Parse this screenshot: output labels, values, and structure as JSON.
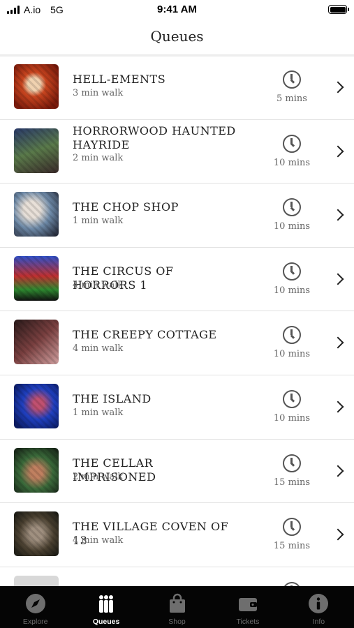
{
  "status": {
    "carrier": "A.io",
    "network": "5G",
    "time": "9:41 AM"
  },
  "nav": {
    "title": "Queues"
  },
  "queues": [
    {
      "name": "HELL-EMENTS",
      "walk": "3 min walk",
      "wait": "5 mins"
    },
    {
      "name": "HORRORWOOD HAUNTED HAYRIDE",
      "walk": "2 min walk",
      "wait": "10 mins"
    },
    {
      "name": "THE CHOP SHOP",
      "walk": "1 min walk",
      "wait": "10 mins"
    },
    {
      "name": "THE CIRCUS OF HORRORS 1",
      "walk": "4 min walk",
      "wait": "10 mins"
    },
    {
      "name": "THE CREEPY COTTAGE",
      "walk": "4 min walk",
      "wait": "10 mins"
    },
    {
      "name": "THE ISLAND",
      "walk": "1 min walk",
      "wait": "10 mins"
    },
    {
      "name": "THE CELLAR IMPRISONED",
      "walk": "2 min walk",
      "wait": "15 mins"
    },
    {
      "name": "THE VILLAGE COVEN OF 13",
      "walk": "4 min walk",
      "wait": "15 mins"
    }
  ],
  "tabs": [
    {
      "label": "Explore",
      "icon": "compass-icon",
      "active": false
    },
    {
      "label": "Queues",
      "icon": "people-queue-icon",
      "active": true
    },
    {
      "label": "Shop",
      "icon": "shopping-bag-icon",
      "active": false
    },
    {
      "label": "Tickets",
      "icon": "wallet-icon",
      "active": false
    },
    {
      "label": "Info",
      "icon": "info-icon",
      "active": false
    }
  ]
}
